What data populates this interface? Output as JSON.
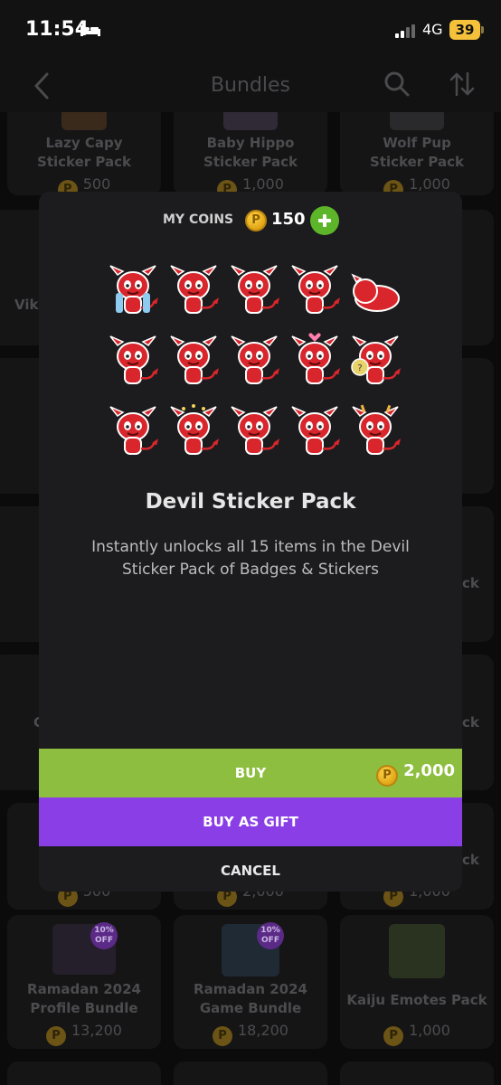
{
  "status_bar": {
    "time": "11:54",
    "network": "4G",
    "battery": "39"
  },
  "header": {
    "title": "Bundles"
  },
  "background_cards": [
    {
      "title": "Lazy Capy Sticker Pack",
      "line1": "Lazy Capy",
      "line2": "Sticker Pack",
      "price": "500"
    },
    {
      "title": "Baby Hippo Sticker Pack",
      "line1": "Baby Hippo",
      "line2": "Sticker Pack",
      "price": "1,000"
    },
    {
      "title": "Wolf Pup Sticker Pack",
      "line1": "Wolf Pup",
      "line2": "Sticker Pack",
      "price": "1,000"
    },
    {
      "prices_row": [
        "500",
        "2,000",
        "1,000"
      ]
    },
    {
      "title": "Ramadan 2024 Profile Bundle",
      "line1": "Ramadan 2024",
      "line2": "Profile Bundle",
      "price": "13,200",
      "badge": "10% OFF"
    },
    {
      "title": "Ramadan 2024 Game Bundle",
      "line1": "Ramadan 2024",
      "line2": "Game Bundle",
      "price": "18,200",
      "badge": "10% OFF"
    },
    {
      "title": "Kaiju Emotes Pack",
      "line1": "Kaiju Emotes Pack",
      "price": "1,000"
    }
  ],
  "partial_labels": {
    "left_vik": "Vik",
    "right_ck_1": "ck",
    "left_c": "C",
    "right_ck_2": "ck",
    "right_ck_3": "ck"
  },
  "modal": {
    "coins_label": "MY COINS",
    "coin_symbol": "P",
    "coins_value": "150",
    "pack_title": "Devil Sticker Pack",
    "pack_description": "Instantly unlocks all 15 items in the Devil Sticker Pack of Badges & Stickers",
    "sticker_count": 15,
    "buy_label": "BUY",
    "buy_price": "2,000",
    "gift_label": "BUY AS GIFT",
    "cancel_label": "CANCEL"
  },
  "colors": {
    "buy": "#8ebe3f",
    "gift": "#8a3ee6",
    "devil": "#d8262c",
    "coin": "#f2b71c",
    "add": "#5db62a"
  }
}
